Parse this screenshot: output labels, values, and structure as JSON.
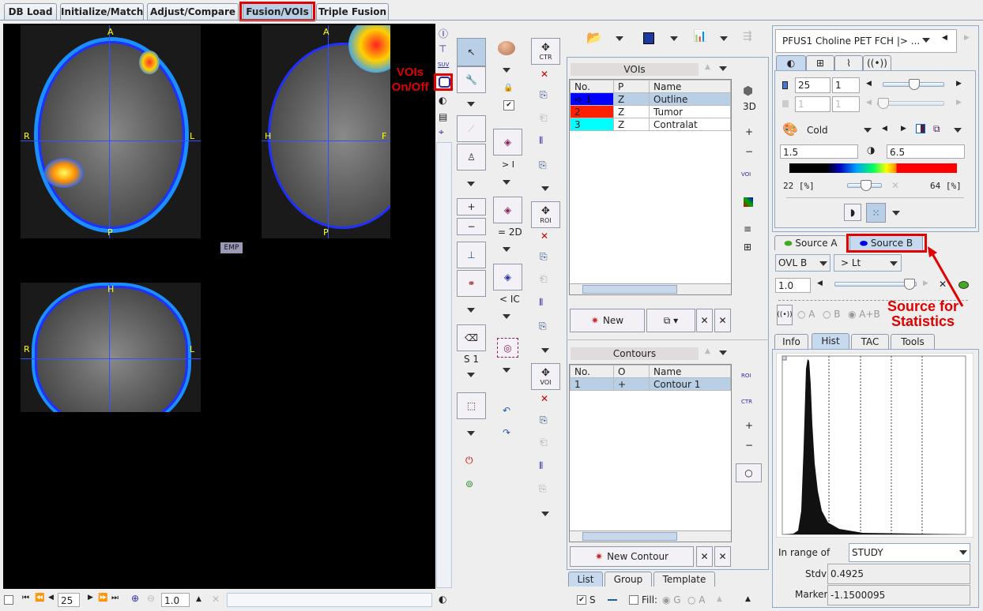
{
  "tabs": [
    {
      "label": "DB Load"
    },
    {
      "label": "Initialize/Match"
    },
    {
      "label": "Adjust/Compare"
    },
    {
      "label": "Fusion/VOIs"
    },
    {
      "label": "Triple Fusion"
    }
  ],
  "viewer": {
    "axial": {
      "top": "A",
      "bottom": "P",
      "left": "R",
      "right": "L"
    },
    "sagittal": {
      "top": "A",
      "bottom": "P",
      "left": "H",
      "right": "F"
    },
    "coronal": {
      "top": "H",
      "left": "R",
      "right": "L"
    },
    "emp_label": "EMP"
  },
  "annotations": {
    "vois_onoff": "VOIs On/Off",
    "source_stats": "Source for Statistics"
  },
  "side_icons": {
    "suv": "SUV"
  },
  "tools": {
    "gt_i": "> I",
    "eq_2d": "= 2D",
    "lt_ic": "< IC",
    "s1": "S 1",
    "ctr": "CTR",
    "roi": "ROI",
    "voi": "VOI",
    "plus": "+",
    "minus": "−",
    "three_d": "3D",
    "roi_small": "ROI",
    "ctr_small": "CTR",
    "voi_small": "VOI"
  },
  "vois": {
    "title": "VOIs",
    "columns": [
      "No.",
      "P",
      "Name"
    ],
    "rows": [
      {
        "no": "1",
        "p": "Z",
        "name": "Outline",
        "color": "#0000ff"
      },
      {
        "no": "2",
        "p": "Z",
        "name": "Tumor",
        "color": "#ff2000"
      },
      {
        "no": "3",
        "p": "Z",
        "name": "Contralat",
        "color": "#00ffff"
      }
    ],
    "new_label": "New"
  },
  "contours": {
    "title": "Contours",
    "columns": [
      "No.",
      "O",
      "Name"
    ],
    "rows": [
      {
        "no": "1",
        "o": "+",
        "name": "Contour 1"
      }
    ],
    "new_label": "New Contour"
  },
  "list_tabs": [
    {
      "label": "List"
    },
    {
      "label": "Group"
    },
    {
      "label": "Template"
    }
  ],
  "bottom_mid": {
    "s_label": "S",
    "s_checked": true,
    "fill_label": "Fill:",
    "g_label": "G",
    "a_label": "A"
  },
  "right": {
    "series": "PFUS1 Choline PET FCH |> ...",
    "frame": "25",
    "frame_step": "1",
    "frame_slider": 0.5,
    "frame2": "1",
    "frame2_step": "1",
    "colormap": "Cold",
    "min": "1.5",
    "max": "6.5",
    "lower_pct": "22",
    "upper_pct": "64",
    "pct_unit": "[%]",
    "source_a": "Source A",
    "source_b": "Source B",
    "ovl": "OVL B",
    "threshold_mode": "> Lt",
    "opacity": "1.0",
    "opacity_level": 0.9,
    "radio_a": "A",
    "radio_b": "B",
    "radio_ab": "A+B",
    "radio_selected": "A+B",
    "info_tabs": [
      {
        "label": "Info"
      },
      {
        "label": "Hist"
      },
      {
        "label": "TAC"
      },
      {
        "label": "Tools"
      }
    ],
    "in_range_label": "In range of",
    "in_range": "STUDY",
    "stdv_label": "Stdv",
    "stdv": "0.4925",
    "marker_label": "Marker",
    "marker": "-1.1500095"
  },
  "bottom_bar": {
    "slice": "25",
    "zoom": "1.0"
  },
  "colors": {
    "accent": "#b8cfe5",
    "annotation": "#e00000",
    "source_a": "#44aa22",
    "source_b": "#0000ee"
  }
}
